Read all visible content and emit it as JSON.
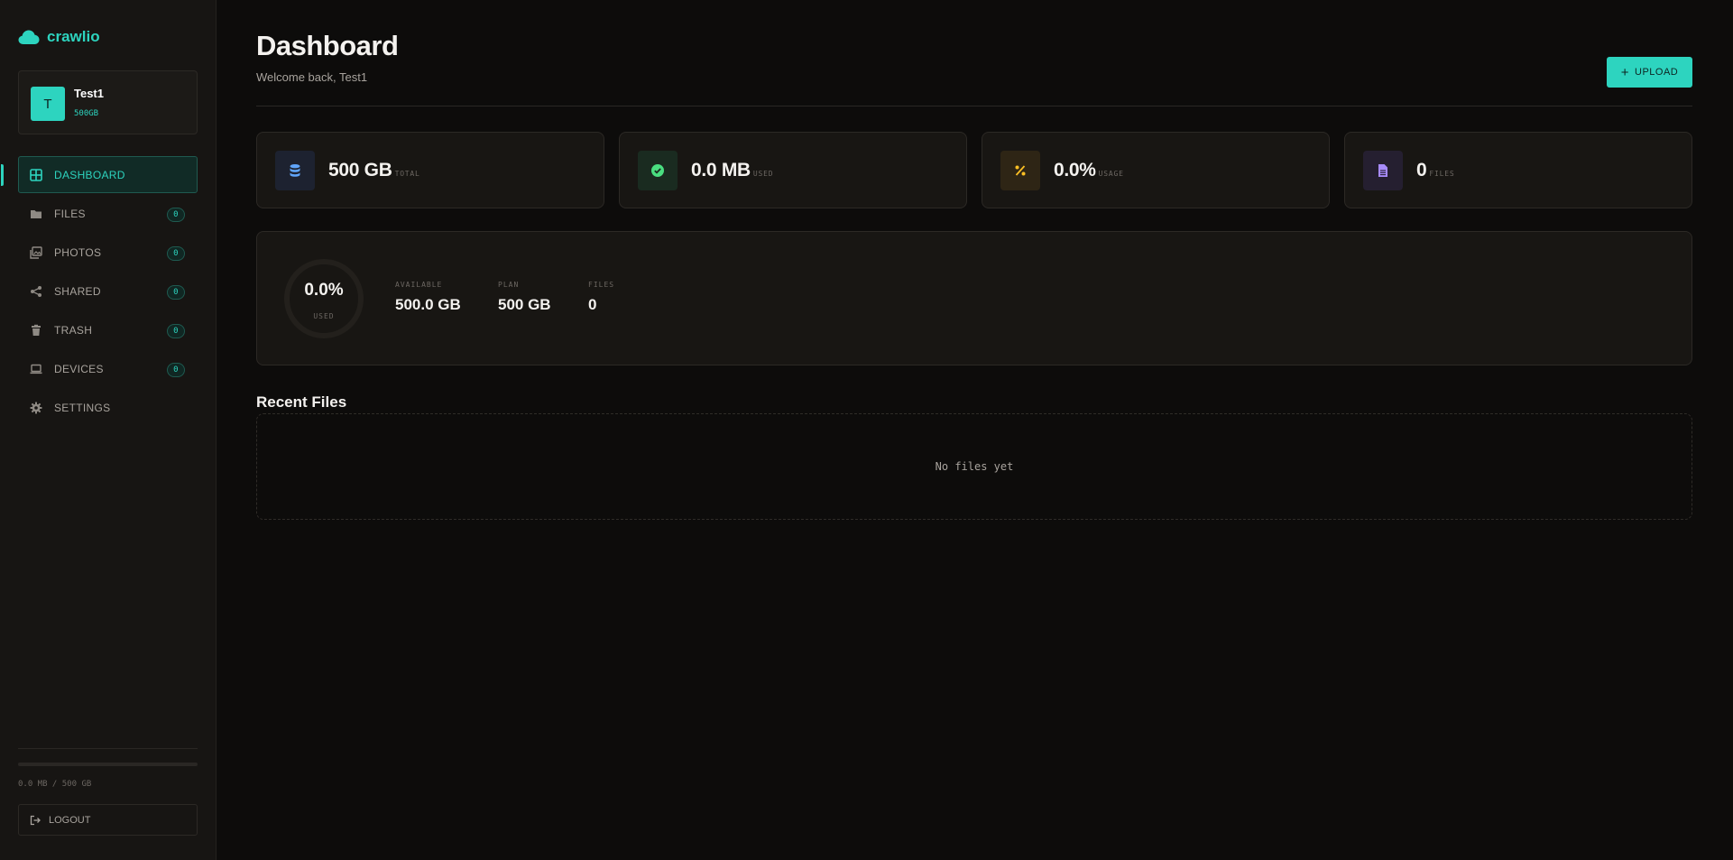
{
  "brand": {
    "name": "crawlio",
    "icon": "cloud-icon",
    "color": "#2dd4bf"
  },
  "user": {
    "initial": "T",
    "name": "Test1",
    "plan": "500GB"
  },
  "nav": [
    {
      "label": "DASHBOARD",
      "icon": "grid-icon",
      "active": true
    },
    {
      "label": "FILES",
      "icon": "folder-icon",
      "badge": "0"
    },
    {
      "label": "PHOTOS",
      "icon": "images-icon",
      "badge": "0"
    },
    {
      "label": "SHARED",
      "icon": "share-icon",
      "badge": "0"
    },
    {
      "label": "TRASH",
      "icon": "trash-icon",
      "badge": "0"
    },
    {
      "label": "DEVICES",
      "icon": "laptop-icon",
      "badge": "0"
    },
    {
      "label": "SETTINGS",
      "icon": "gear-icon"
    }
  ],
  "storage": {
    "text": "0.0 MB / 500 GB",
    "used_fraction": 0
  },
  "logout_label": "LOGOUT",
  "header": {
    "title": "Dashboard",
    "subtitle": "Welcome back, Test1",
    "upload_label": "UPLOAD"
  },
  "stats": [
    {
      "value": "500 GB",
      "label": "TOTAL",
      "icon": "database-icon",
      "color": "#60a5fa"
    },
    {
      "value": "0.0 MB",
      "label": "USED",
      "icon": "check-circle-icon",
      "color": "#4ade80"
    },
    {
      "value": "0.0%",
      "label": "USAGE",
      "icon": "percent-icon",
      "color": "#fbbf24"
    },
    {
      "value": "0",
      "label": "FILES",
      "icon": "file-icon",
      "color": "#a78bfa"
    }
  ],
  "overview": {
    "percent": "0.0%",
    "percent_label": "USED",
    "used_fraction": 0,
    "items": [
      {
        "label": "AVAILABLE",
        "value": "500.0 GB"
      },
      {
        "label": "PLAN",
        "value": "500 GB"
      },
      {
        "label": "FILES",
        "value": "0"
      }
    ]
  },
  "recent": {
    "title": "Recent Files",
    "empty_text": "No files yet"
  }
}
